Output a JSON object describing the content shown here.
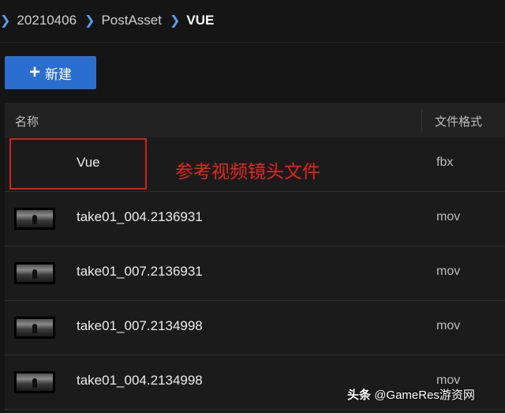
{
  "breadcrumb": {
    "items": [
      "20210406",
      "PostAsset",
      "VUE"
    ]
  },
  "toolbar": {
    "new_label": "新建"
  },
  "table": {
    "columns": {
      "name": "名称",
      "format": "文件格式"
    },
    "rows": [
      {
        "name": "Vue",
        "format": "fbx",
        "has_thumbnail": false
      },
      {
        "name": "take01_004.2136931",
        "format": "mov",
        "has_thumbnail": true
      },
      {
        "name": "take01_007.2136931",
        "format": "mov",
        "has_thumbnail": true
      },
      {
        "name": "take01_007.2134998",
        "format": "mov",
        "has_thumbnail": true
      },
      {
        "name": "take01_004.2134998",
        "format": "mov",
        "has_thumbnail": true
      }
    ]
  },
  "annotation": {
    "text": "参考视频镜头文件",
    "color": "#e3261c"
  },
  "watermark": {
    "brand": "头条",
    "handle": "@GameRes游资网"
  },
  "colors": {
    "accent": "#2a6fd0",
    "background": "#151515"
  }
}
